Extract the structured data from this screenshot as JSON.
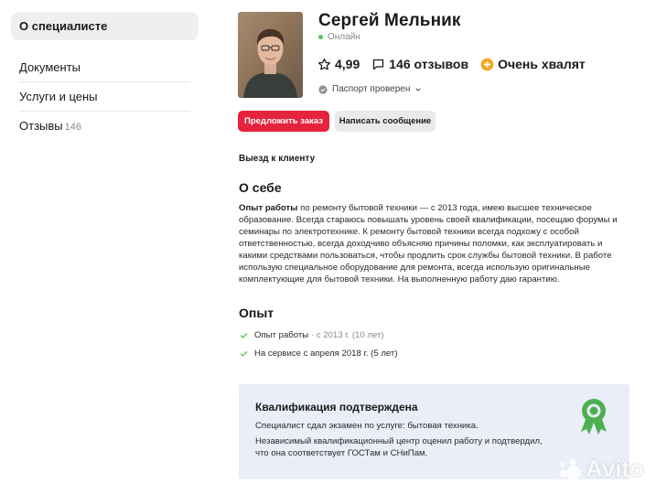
{
  "sidebar": {
    "items": [
      {
        "label": "О специалисте"
      },
      {
        "label": "Документы"
      },
      {
        "label": "Услуги и цены"
      },
      {
        "label": "Отзывы",
        "count": "146"
      }
    ]
  },
  "profile": {
    "name": "Сергей Мельник",
    "status": "Онлайн",
    "rating": "4,99",
    "reviews": "146 отзывов",
    "praise": "Очень хвалят",
    "verified": "Паспорт проверен"
  },
  "actions": {
    "order": "Предложить заказ",
    "message": "Написать сообщение"
  },
  "departure": "Выезд к клиенту",
  "about": {
    "title": "О себе",
    "lead": "Опыт работы",
    "text": " по ремонту бытовой техники — с 2013 года, имею высшее техническое образование. Всегда стараюсь повышать уровень своей квалификации, посещаю форумы и семинары по электротехнике. К ремонту бытовой техники всегда подхожу с особой ответственностью, всегда доходчиво объясняю причины поломки, как эксплуатировать и какими средствами пользоваться, чтобы продлить срок службы бытовой техники. В работе использую специальное оборудование для ремонта, всегда использую оригинальные комплектующие для бытовой техники. На выполненную работу даю гарантию."
  },
  "experience": {
    "title": "Опыт",
    "items": [
      {
        "label": "Опыт работы",
        "detail": "· с 2013 г. (10 лет)"
      },
      {
        "label": "На сервисе с апреля 2018 г. (5 лет)",
        "detail": ""
      }
    ]
  },
  "qualification": {
    "title": "Квалификация подтверждена",
    "line1": "Специалист сдал экзамен по услуге: бытовая техника.",
    "line2": "Независимый квалификационный центр оценил работу и подтвердил, что она соответствует ГОСТам и СНиПам."
  },
  "watermark": "Avito",
  "colors": {
    "accent": "#e5233c",
    "online": "#57c45a",
    "check": "#57c45a",
    "badge": "#4caf50",
    "praise": "#f5a623",
    "card": "#e9eef8"
  }
}
